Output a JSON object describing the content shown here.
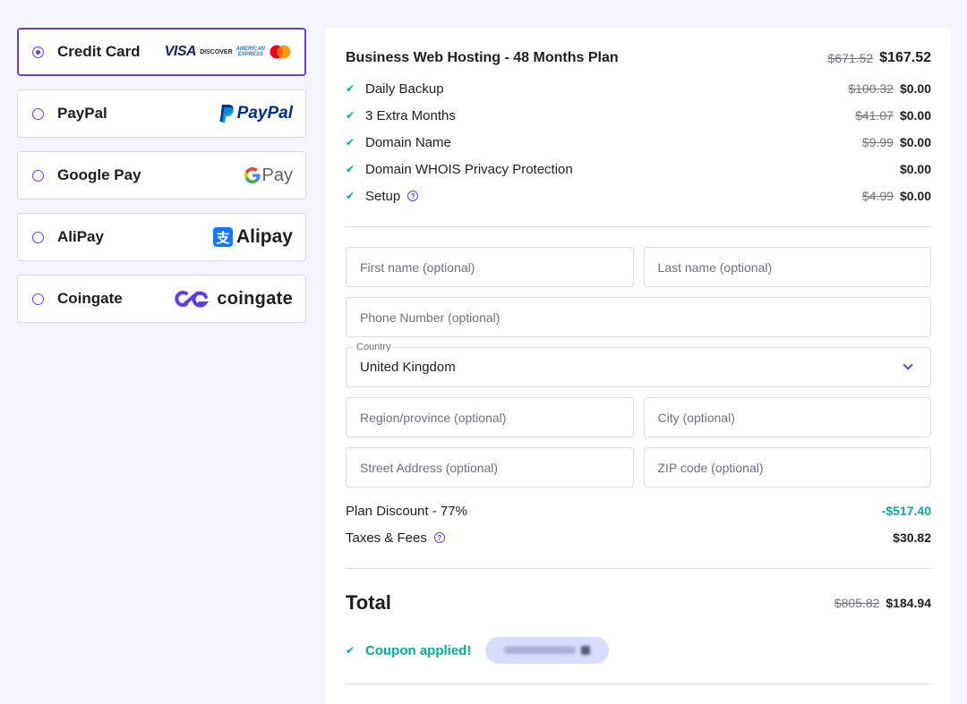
{
  "payment_methods": [
    {
      "label": "Credit Card",
      "selected": true,
      "logo_icons": [
        "visa-icon",
        "discover-icon",
        "amex-icon",
        "mastercard-icon"
      ]
    },
    {
      "label": "PayPal",
      "selected": false,
      "logo_text": "PayPal"
    },
    {
      "label": "Google Pay",
      "selected": false,
      "logo_text": "Pay"
    },
    {
      "label": "AliPay",
      "selected": false,
      "logo_text": "Alipay"
    },
    {
      "label": "Coingate",
      "selected": false,
      "logo_text": "coingate"
    }
  ],
  "card_logos": {
    "visa": "VISA",
    "discover": "DISCOVER",
    "amex_line1": "AMERICAN",
    "amex_line2": "EXPRESS"
  },
  "plan": {
    "title": "Business Web Hosting - 48 Months Plan",
    "old_price": "$671.52",
    "new_price": "$167.52"
  },
  "items": [
    {
      "label": "Daily Backup",
      "old_price": "$100.32",
      "price": "$0.00"
    },
    {
      "label": "3 Extra Months",
      "old_price": "$41.07",
      "price": "$0.00"
    },
    {
      "label": "Domain Name",
      "old_price": "$9.99",
      "price": "$0.00"
    },
    {
      "label": "Domain WHOIS Privacy Protection",
      "old_price": "",
      "price": "$0.00"
    },
    {
      "label": "Setup",
      "old_price": "$4.99",
      "price": "$0.00",
      "help": true
    }
  ],
  "form": {
    "first_name_placeholder": "First name (optional)",
    "last_name_placeholder": "Last name (optional)",
    "phone_placeholder": "Phone Number (optional)",
    "country_label": "Country",
    "country_value": "United Kingdom",
    "region_placeholder": "Region/province (optional)",
    "city_placeholder": "City (optional)",
    "street_placeholder": "Street Address (optional)",
    "zip_placeholder": "ZIP code (optional)"
  },
  "summary": {
    "discount_label": "Plan Discount - 77%",
    "discount_value": "-$517.40",
    "taxes_label": "Taxes & Fees",
    "taxes_value": "$30.82"
  },
  "total": {
    "label": "Total",
    "old_price": "$805.82",
    "new_price": "$184.94"
  },
  "coupon": {
    "text": "Coupon applied!"
  },
  "colors": {
    "accent": "#673de6",
    "success": "#00b090",
    "background": "#f4f5ff"
  }
}
